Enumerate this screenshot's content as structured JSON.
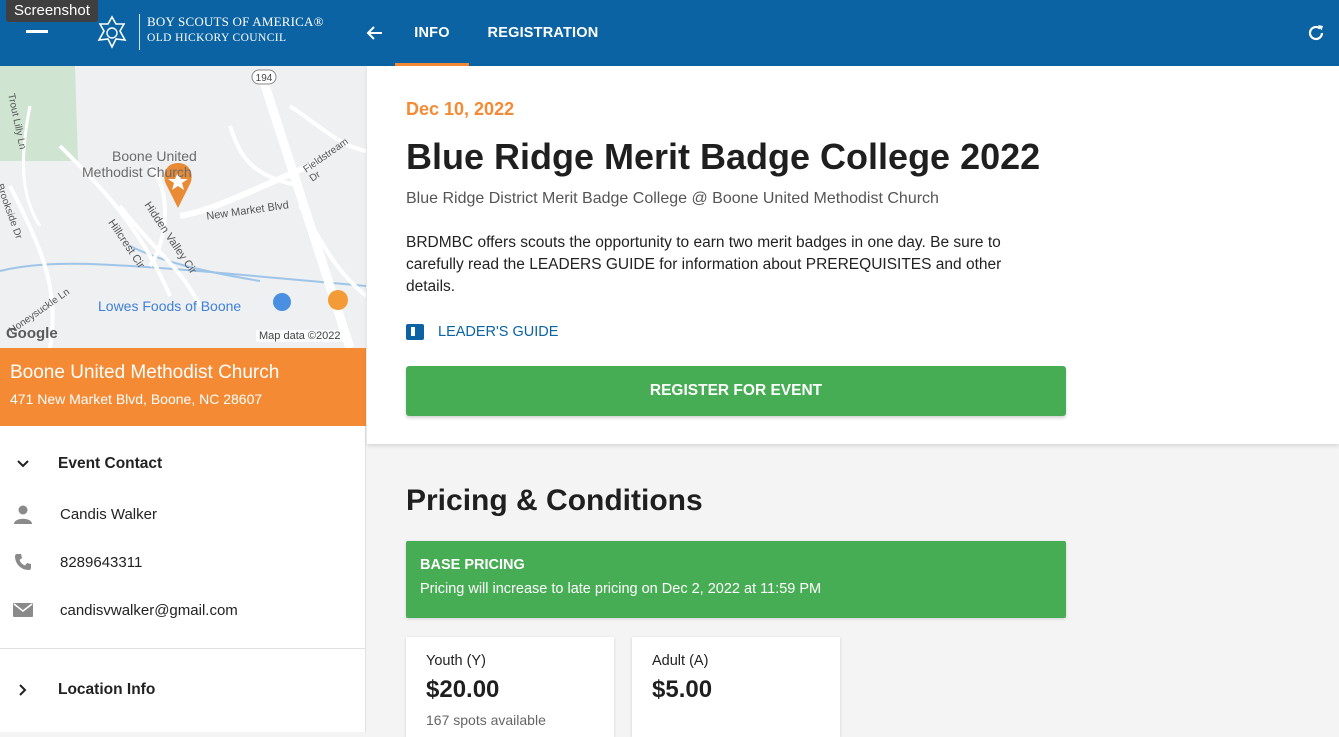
{
  "screenshot_label": "Screenshot",
  "header": {
    "org_line1": "BOY SCOUTS OF AMERICA®",
    "org_line2": "OLD HICKORY COUNCIL",
    "tabs": [
      {
        "label": "INFO",
        "active": true
      },
      {
        "label": "REGISTRATION",
        "active": false
      }
    ],
    "accent": "#f58a35",
    "bar_color": "#0b63a3"
  },
  "map": {
    "labels": {
      "road_194": "194",
      "church": "Boone United Methodist Church",
      "church_line1": "Boone United",
      "church_line2": "Methodist Church",
      "new_market": "New Market Blvd",
      "hidden_valley": "Hidden Valley Cir",
      "hillcrest": "Hillcrest Cir",
      "fieldstream": "Fieldstream Dr",
      "trout_lilly": "Trout Lilly Ln",
      "brookside": "Brookside Dr",
      "honeysuckle": "Honeysuckle Ln",
      "lowes": "Lowes Foods of Boone",
      "google": "Google",
      "map_data": "Map data ©2022"
    }
  },
  "venue": {
    "name": "Boone United Methodist Church",
    "address": "471 New Market Blvd, Boone, NC 28607"
  },
  "contact": {
    "section_label": "Event Contact",
    "name": "Candis Walker",
    "phone": "8289643311",
    "email": "candisvwalker@gmail.com",
    "icons": {
      "person": "person-icon",
      "phone": "phone-icon",
      "email": "email-icon"
    }
  },
  "location": {
    "section_label": "Location Info"
  },
  "event": {
    "date": "Dec 10, 2022",
    "title": "Blue Ridge Merit Badge College 2022",
    "subtitle": "Blue Ridge District Merit Badge College @ Boone United Methodist Church",
    "description": "BRDMBC offers scouts the opportunity to earn two merit badges in one day. Be sure to carefully read the LEADERS GUIDE for information about PREREQUISITES and other details.",
    "guide_label": "LEADER'S GUIDE",
    "register_label": "REGISTER FOR EVENT"
  },
  "pricing": {
    "title": "Pricing & Conditions",
    "base_title": "BASE PRICING",
    "base_note": "Pricing will increase to late pricing on Dec 2, 2022 at 11:59 PM",
    "tiers": [
      {
        "label": "Youth (Y)",
        "price": "$20.00",
        "spots": "167 spots available"
      },
      {
        "label": "Adult (A)",
        "price": "$5.00",
        "spots": ""
      }
    ],
    "box_color": "#47ad54"
  }
}
